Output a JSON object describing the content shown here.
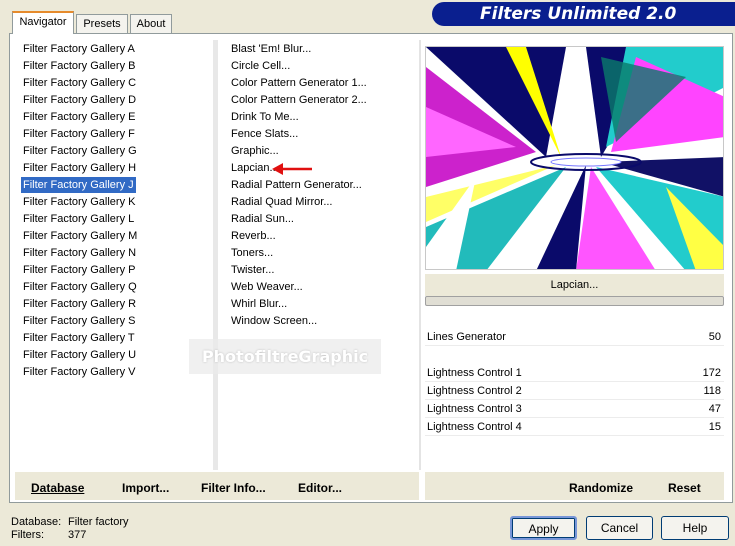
{
  "app": {
    "title": "Filters Unlimited 2.0"
  },
  "tabs": [
    {
      "label": "Navigator"
    },
    {
      "label": "Presets"
    },
    {
      "label": "About"
    }
  ],
  "categories": [
    "Filter Factory Gallery A",
    "Filter Factory Gallery B",
    "Filter Factory Gallery C",
    "Filter Factory Gallery D",
    "Filter Factory Gallery E",
    "Filter Factory Gallery F",
    "Filter Factory Gallery G",
    "Filter Factory Gallery H",
    "Filter Factory Gallery J",
    "Filter Factory Gallery K",
    "Filter Factory Gallery L",
    "Filter Factory Gallery M",
    "Filter Factory Gallery N",
    "Filter Factory Gallery P",
    "Filter Factory Gallery Q",
    "Filter Factory Gallery R",
    "Filter Factory Gallery S",
    "Filter Factory Gallery T",
    "Filter Factory Gallery U",
    "Filter Factory Gallery V"
  ],
  "selected_category_index": 8,
  "filters": [
    "Blast 'Em! Blur...",
    "Circle Cell...",
    "Color Pattern Generator 1...",
    "Color Pattern Generator 2...",
    "Drink To Me...",
    "Fence Slats...",
    "Graphic...",
    "Lapcian...",
    "Radial Pattern Generator...",
    "Radial Quad Mirror...",
    "Radial Sun...",
    "Reverb...",
    "Toners...",
    "Twister...",
    "Web Weaver...",
    "Whirl Blur...",
    "Window Screen..."
  ],
  "watermark": "PhotofiltreGraphic",
  "preview": {
    "filter_name": "Lapcian..."
  },
  "parameters": [
    {
      "label": "Lines Generator",
      "value": "50"
    },
    {
      "label": "Lightness Control 1",
      "value": "172"
    },
    {
      "label": "Lightness Control 2",
      "value": "118"
    },
    {
      "label": "Lightness Control 3",
      "value": "47"
    },
    {
      "label": "Lightness Control 4",
      "value": "15"
    }
  ],
  "toolbar": {
    "database": "Database",
    "import": "Import...",
    "filter_info": "Filter Info...",
    "editor": "Editor...",
    "randomize": "Randomize",
    "reset": "Reset"
  },
  "status": {
    "database_label": "Database:",
    "database_value": "Filter factory",
    "filters_label": "Filters:",
    "filters_value": "377"
  },
  "buttons": {
    "apply": "Apply",
    "cancel": "Cancel",
    "help": "Help"
  },
  "colors": {
    "selection": "#316ac5",
    "banner": "#0a1f8f",
    "arrow": "#e01010"
  }
}
